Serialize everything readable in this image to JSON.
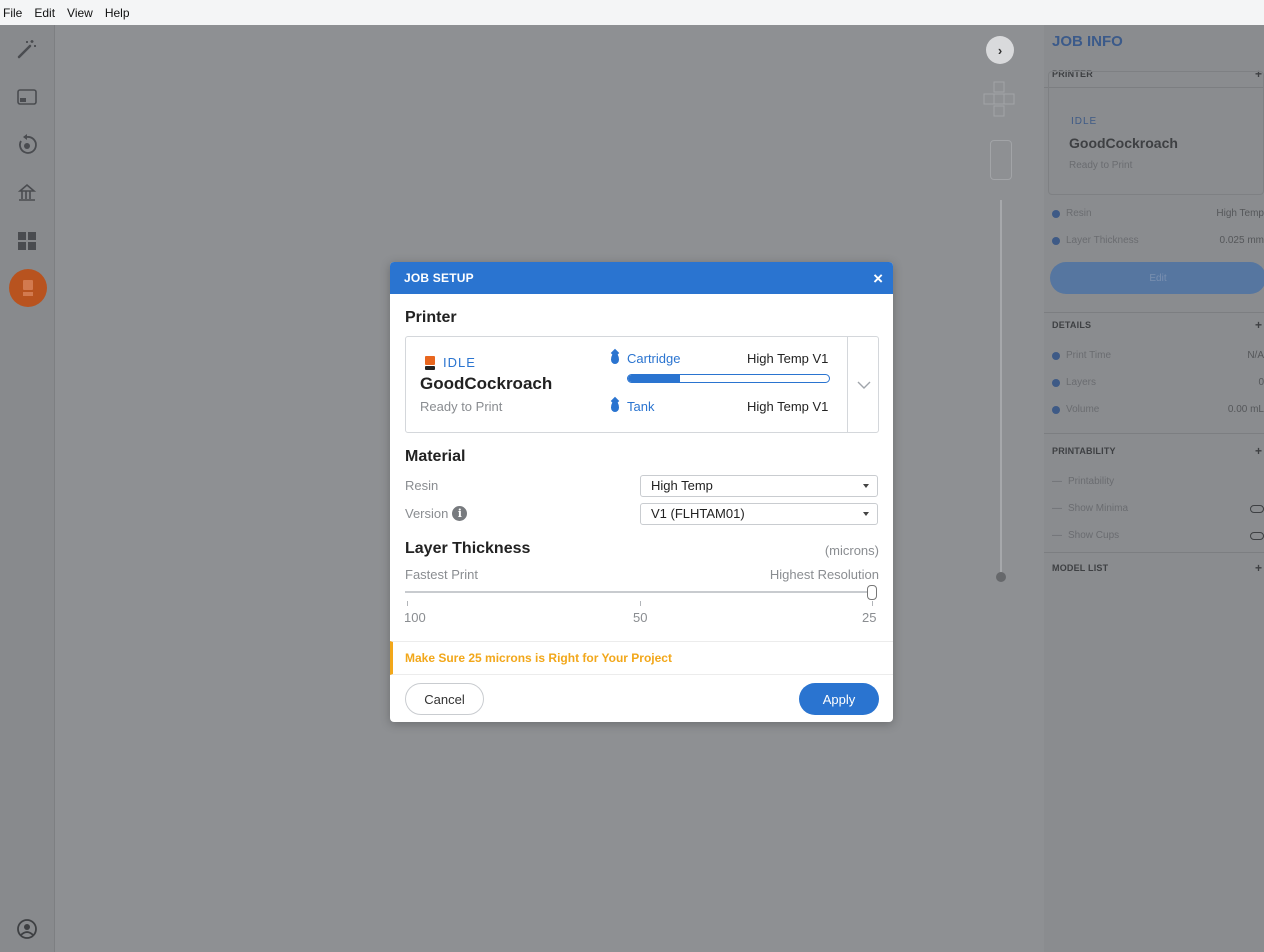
{
  "menu": {
    "file": "File",
    "edit": "Edit",
    "view": "View",
    "help": "Help"
  },
  "toolbar": {
    "tools": [
      "magic-wand-icon",
      "monitor-icon",
      "rotate-icon",
      "supports-icon",
      "layout-icon",
      "printer-icon"
    ],
    "bottom_icon": "user-icon"
  },
  "viewport": {
    "nav_glyph": "›"
  },
  "job_info": {
    "title": "JOB INFO",
    "printer_heading": "PRINTER",
    "status": "IDLE",
    "name": "GoodCockroach",
    "sub": "Ready to Print",
    "resin_label": "Resin",
    "resin_value": "High Temp",
    "layer_label": "Layer Thickness",
    "layer_value": "0.025 mm",
    "edit_label": "Edit",
    "details_heading": "DETAILS",
    "print_time_label": "Print Time",
    "print_time_value": "N/A",
    "layers_label": "Layers",
    "layers_value": "0",
    "volume_label": "Volume",
    "volume_value": "0.00 mL",
    "printability_heading": "PRINTABILITY",
    "printability_label": "Printability",
    "show_minima_label": "Show Minima",
    "show_cups_label": "Show Cups",
    "model_list_heading": "MODEL LIST",
    "plus": "+"
  },
  "dialog": {
    "title": "JOB SETUP",
    "close": "×",
    "printer_section": "Printer",
    "printer_status": "IDLE",
    "printer_name": "GoodCockroach",
    "printer_sub": "Ready to Print",
    "cartridge_label": "Cartridge",
    "cartridge_value": "High Temp V1",
    "cartridge_level": 0.26,
    "tank_label": "Tank",
    "tank_value": "High Temp V1",
    "material_section": "Material",
    "resin_label": "Resin",
    "resin_value": "High Temp",
    "version_label": "Version",
    "version_value": "V1 (FLHTAM01)",
    "layer_section": "Layer Thickness",
    "units": "(microns)",
    "fastest": "Fastest Print",
    "highest": "Highest Resolution",
    "ticks": [
      "100",
      "50",
      "25"
    ],
    "selected_microns": 25,
    "warning": "Make Sure 25 microns is Right for Your Project",
    "cancel": "Cancel",
    "apply": "Apply"
  }
}
